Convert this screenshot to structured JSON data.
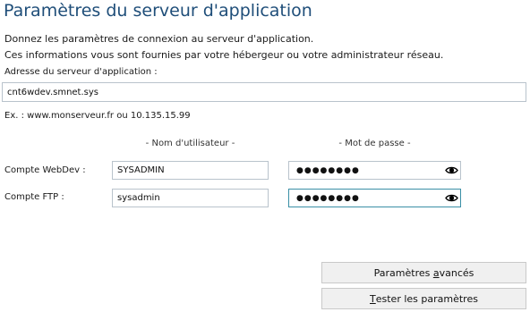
{
  "header": {
    "title": "Paramètres du serveur d'application"
  },
  "intro": {
    "line1": "Donnez les paramètres de connexion au serveur d'application.",
    "line2": "Ces informations vous sont fournies par votre hébergeur ou votre administrateur réseau."
  },
  "server": {
    "label": "Adresse du serveur d'application :",
    "value": "cnt6wdev.smnet.sys",
    "example": "Ex. : www.monserveur.fr ou 10.135.15.99"
  },
  "columns": {
    "username": "- Nom d'utilisateur -",
    "password": "- Mot de passe -"
  },
  "accounts": [
    {
      "label": "Compte WebDev :",
      "username": "SYSADMIN",
      "password_mask": "●●●●●●●●"
    },
    {
      "label": "Compte FTP :",
      "username": "sysadmin",
      "password_mask": "●●●●●●●●"
    }
  ],
  "buttons": {
    "advanced": {
      "before": "Paramètres ",
      "mnemonic": "a",
      "after": "vancés"
    },
    "test": {
      "before": "",
      "mnemonic": "T",
      "after": "ester les paramètres"
    }
  },
  "icons": {
    "reveal": "eye-icon"
  },
  "colors": {
    "title": "#1f4e79",
    "focus_border": "#3a8fa6"
  }
}
